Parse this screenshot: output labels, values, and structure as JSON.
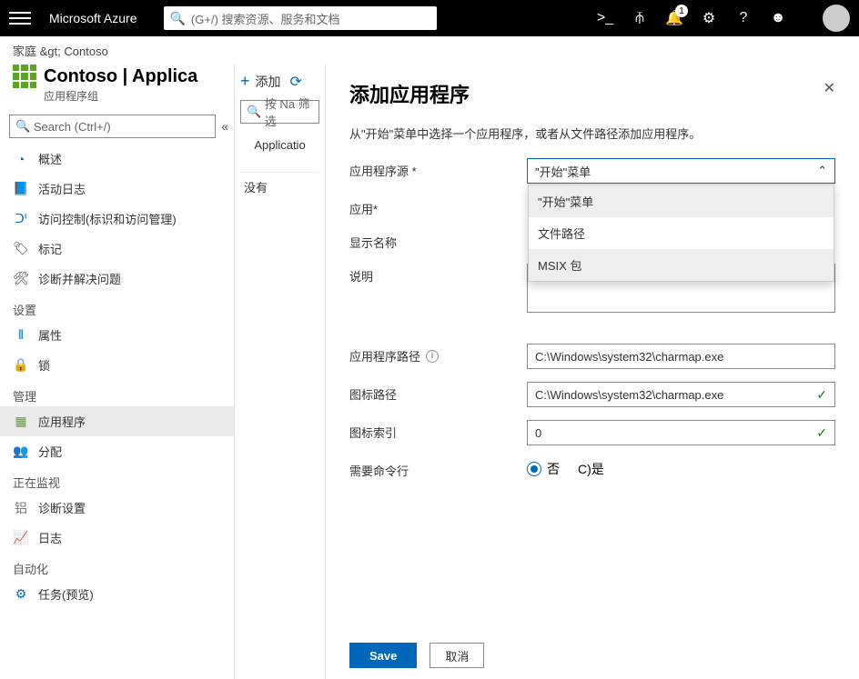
{
  "topbar": {
    "brand": "Microsoft Azure",
    "search_placeholder": "(G+/) 搜索资源、服务和文档",
    "notif_badge": "1"
  },
  "breadcrumb": {
    "home": "家庭",
    "sep": " > ",
    "current": "Contoso"
  },
  "side": {
    "title": "Contoso | Applica",
    "subtitle": "应用程序组",
    "search_placeholder": "Search (Ctrl+/)",
    "items": {
      "overview": "概述",
      "activity": "活动日志",
      "access": "访问控制(标识和访问管理)",
      "tags": "标记",
      "diagnose": "诊断并解决问题"
    },
    "sections": {
      "settings": "设置",
      "settings_items": {
        "properties": "属性",
        "locks": "锁"
      },
      "manage": "管理",
      "manage_items": {
        "apps": "应用程序",
        "assign": "分配"
      },
      "monitor": "正在监视",
      "monitor_items": {
        "diag": "诊断设置",
        "logs": "日志"
      },
      "automation": "自动化",
      "automation_items": {
        "tasks": "任务(预览)"
      }
    }
  },
  "mid": {
    "add": "添加",
    "filter_placeholder": "按 Na 筛选",
    "column": "Applicatio",
    "empty": "没有"
  },
  "panel": {
    "title": "添加应用程序",
    "desc": "从\"开始\"菜单中选择一个应用程序，或者从文件路径添加应用程序。",
    "labels": {
      "source": "应用程序源 *",
      "app": "应用*",
      "display": "显示名称",
      "note": "说明",
      "path": "应用程序路径",
      "iconpath": "图标路径",
      "iconindex": "图标索引",
      "needcli": "需要命令行"
    },
    "source_value": "\"开始\"菜单",
    "source_options": {
      "start": "\"开始\"菜单",
      "file": "文件路径",
      "msix": "MSIX 包"
    },
    "values": {
      "path": "C:\\Windows\\system32\\charmap.exe",
      "iconpath": "C:\\Windows\\system32\\charmap.exe",
      "iconindex": "0"
    },
    "radio": {
      "no": "否",
      "yes": "C)是"
    },
    "buttons": {
      "save": "Save",
      "cancel": "取消"
    }
  }
}
